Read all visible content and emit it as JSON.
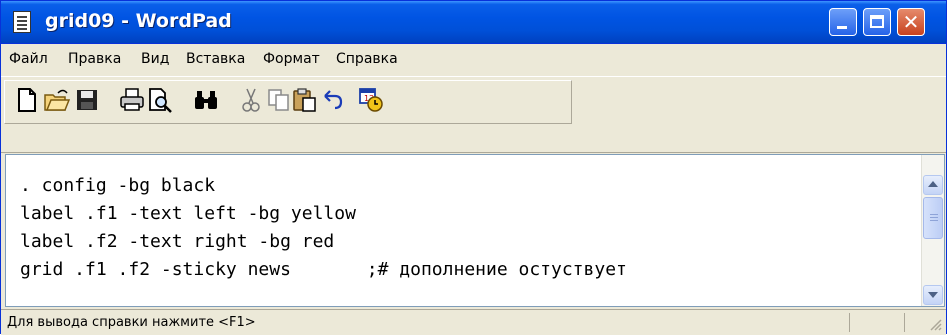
{
  "window": {
    "title": "grid09 - WordPad"
  },
  "menu": [
    "Файл",
    "Правка",
    "Вид",
    "Вставка",
    "Формат",
    "Справка"
  ],
  "toolbar": {
    "icons": [
      "new-document-icon",
      "open-folder-icon",
      "save-disk-icon",
      "print-icon",
      "print-preview-icon",
      "find-binoculars-icon",
      "cut-scissors-icon",
      "copy-icon",
      "paste-clipboard-icon",
      "undo-icon",
      "insert-date-time-icon"
    ]
  },
  "document": {
    "lines": [
      ". config -bg black",
      "label .f1 -text left -bg yellow",
      "label .f2 -text right -bg red",
      "grid .f1 .f2 -sticky news       ;# дополнение остуствует"
    ]
  },
  "status": {
    "text": "Для вывода справки нажмите <F1>"
  },
  "colors": {
    "title_bar": "#0054e3",
    "close_button": "#c7421e",
    "chrome": "#ece9d8"
  }
}
